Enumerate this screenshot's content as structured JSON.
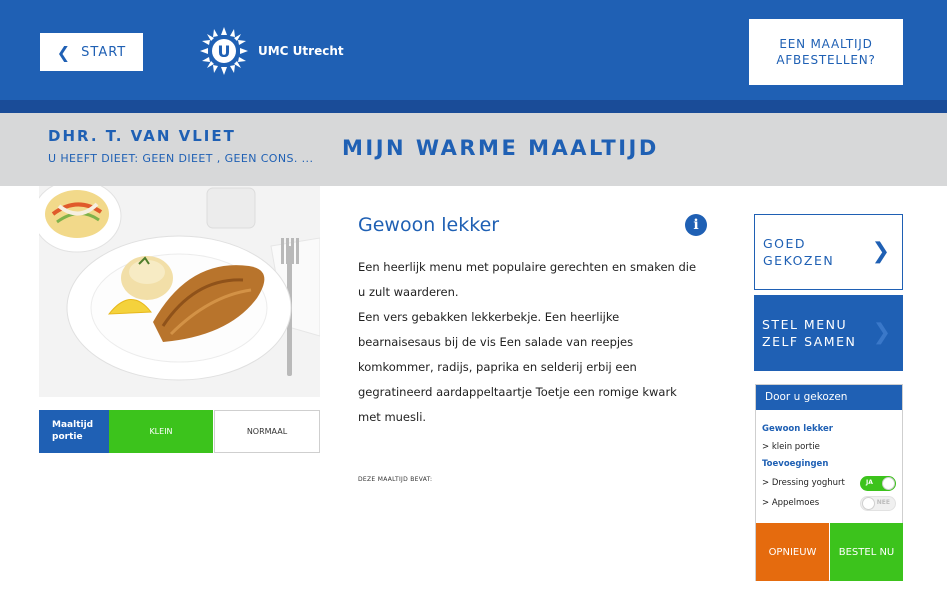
{
  "header": {
    "start_label": "START",
    "logo_text": "UMC Utrecht",
    "cancel_line1": "EEN MAALTIJD",
    "cancel_line2": "AFBESTELLEN?"
  },
  "patient": {
    "name": "DHR. T. VAN VLIET",
    "diet": "U HEEFT DIEET: GEEN DIEET , GEEN CONS. ..."
  },
  "page_title": "MIJN WARME MAALTIJD",
  "portion": {
    "label_line1": "Maaltijd",
    "label_line2": "portie",
    "options": [
      "KLEIN",
      "NORMAAL"
    ],
    "selected": "KLEIN"
  },
  "menu": {
    "title": "Gewoon lekker",
    "description": [
      "Een heerlijk menu met populaire gerechten en smaken die u zult waarderen.",
      "Een vers gebakken lekkerbekje. Een heerlijke bearnaisesaus bij de vis Een salade van reepjes komkommer, radijs, paprika en selderij erbij een gegratineerd aardappeltaartje Toetje een romige kwark met muesli."
    ],
    "contains_label": "DEZE MAALTIJD BEVAT:"
  },
  "sidebar": {
    "good_choice_line1": "GOED",
    "good_choice_line2": "GEKOZEN",
    "compose_line1": "STEL MENU",
    "compose_line2": "ZELF SAMEN"
  },
  "chosen": {
    "header": "Door u gekozen",
    "menu_name": "Gewoon lekker",
    "portion": "> klein portie",
    "extras_header": "Toevoegingen",
    "extras": [
      {
        "label": "> Dressing yoghurt",
        "toggle": "JA",
        "on": true
      },
      {
        "label": "> Appelmoes",
        "toggle": "NEE",
        "on": false
      }
    ],
    "reset_label": "OPNIEUW",
    "order_label": "BESTEL NU"
  },
  "colors": {
    "brand_blue": "#1f60b4",
    "green": "#3cc31c",
    "orange": "#e56b0e",
    "grey_bar": "#d7d8d9"
  }
}
